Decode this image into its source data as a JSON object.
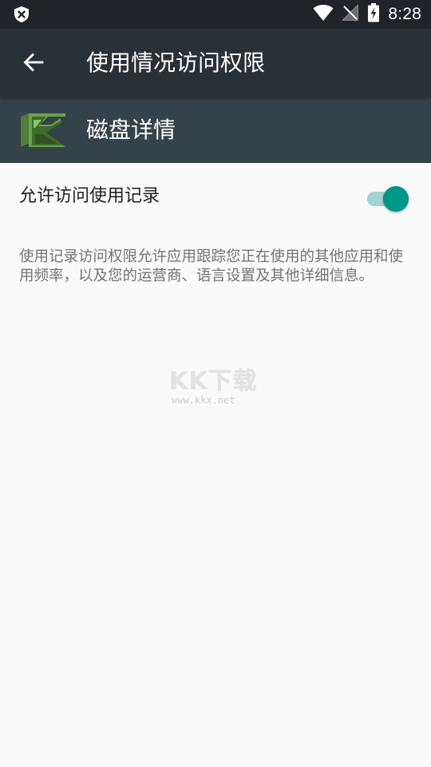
{
  "status_bar": {
    "time": "8:28",
    "left_icon": "shield-x-icon",
    "right_icons": [
      "wifi-icon",
      "signal-off-icon",
      "battery-charging-icon"
    ]
  },
  "app_bar": {
    "back_icon": "arrow-back-icon",
    "title": "使用情况访问权限"
  },
  "app_header": {
    "icon": "app-icon",
    "name": "磁盘详情"
  },
  "preference": {
    "label": "允许访问使用记录",
    "switch_on": true
  },
  "summary": "使用记录访问权限允许应用跟踪您正在使用的其他应用和使用频率，以及您的运营商、语言设置及其他详细信息。",
  "watermark": {
    "logo": "KK下载",
    "url": "www.kkx.net"
  },
  "colors": {
    "status_bar": "#202428",
    "app_bar": "#2a3136",
    "app_header": "#364249",
    "background": "#fafafa",
    "switch_thumb": "#009688",
    "switch_track": "#9fd6d1"
  }
}
